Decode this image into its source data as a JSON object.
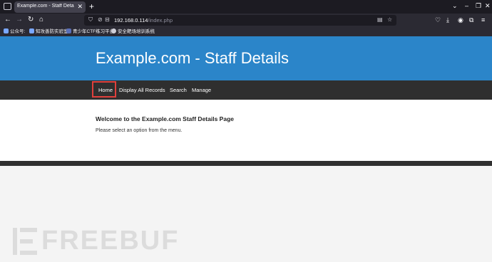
{
  "browser": {
    "tab": {
      "title": "Example.com - Staff Details - We"
    },
    "url": {
      "host": "192.168.0.114",
      "path": "/index.php"
    },
    "bookmarks": [
      "公众号:",
      "知攻善防实验室",
      "青少年CTF练习平台",
      "安全靶场培训系统"
    ]
  },
  "page": {
    "title": "Example.com - Staff Details",
    "nav": [
      "Home",
      "Display All Records",
      "Search",
      "Manage"
    ],
    "welcome": "Welcome to the Example.com Staff Details Page",
    "instruction": "Please select an option from the menu."
  },
  "watermark": "FREEBUF",
  "colors": {
    "header_blue": "#2b85c9",
    "nav_dark": "#2f2f2f",
    "highlight_red": "#e0403c"
  }
}
